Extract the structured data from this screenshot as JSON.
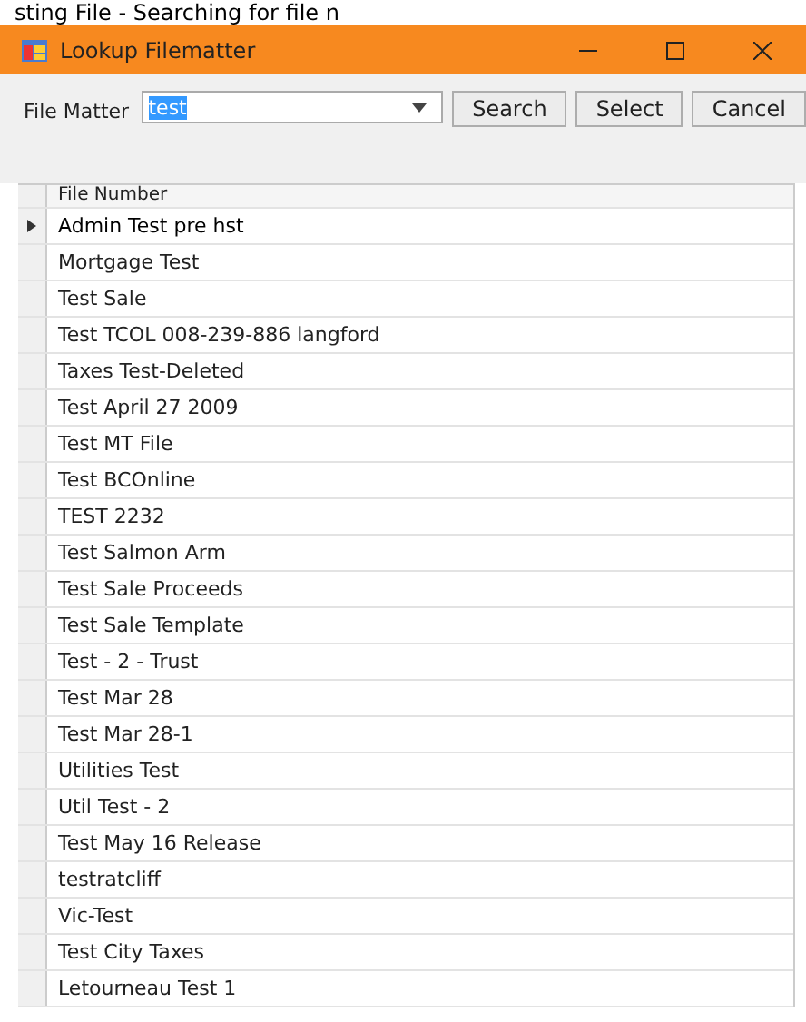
{
  "caption": "sting File - Searching for file n",
  "window": {
    "title": "Lookup Filematter"
  },
  "toolbar": {
    "label": "File Matter",
    "field": {
      "value": "test",
      "text_selected": true
    },
    "buttons": [
      "Search",
      "Select",
      "Cancel"
    ]
  },
  "table": {
    "columns": [
      "File Number"
    ],
    "rows": [
      {
        "cells": [
          "Admin Test pre hst"
        ],
        "selected": true
      },
      {
        "cells": [
          "Mortgage Test"
        ],
        "selected": false
      },
      {
        "cells": [
          "Test Sale"
        ],
        "selected": false
      },
      {
        "cells": [
          "Test TCOL 008-239-886 langford"
        ],
        "selected": false
      },
      {
        "cells": [
          "Taxes Test-Deleted"
        ],
        "selected": false
      },
      {
        "cells": [
          "Test April 27 2009"
        ],
        "selected": false
      },
      {
        "cells": [
          "Test MT File"
        ],
        "selected": false
      },
      {
        "cells": [
          "Test BCOnline"
        ],
        "selected": false
      },
      {
        "cells": [
          "TEST 2232"
        ],
        "selected": false
      },
      {
        "cells": [
          "Test Salmon Arm"
        ],
        "selected": false
      },
      {
        "cells": [
          "Test Sale Proceeds"
        ],
        "selected": false
      },
      {
        "cells": [
          "Test Sale Template"
        ],
        "selected": false
      },
      {
        "cells": [
          "Test - 2 - Trust"
        ],
        "selected": false
      },
      {
        "cells": [
          "Test Mar 28"
        ],
        "selected": false
      },
      {
        "cells": [
          "Test Mar 28-1"
        ],
        "selected": false
      },
      {
        "cells": [
          "Utilities Test"
        ],
        "selected": false
      },
      {
        "cells": [
          "Util Test - 2"
        ],
        "selected": false
      },
      {
        "cells": [
          "Test May 16 Release"
        ],
        "selected": false
      },
      {
        "cells": [
          "testratcliff"
        ],
        "selected": false
      },
      {
        "cells": [
          "Vic-Test"
        ],
        "selected": false
      },
      {
        "cells": [
          "Test City Taxes"
        ],
        "selected": false
      },
      {
        "cells": [
          "Letourneau Test 1"
        ],
        "selected": false
      }
    ]
  }
}
